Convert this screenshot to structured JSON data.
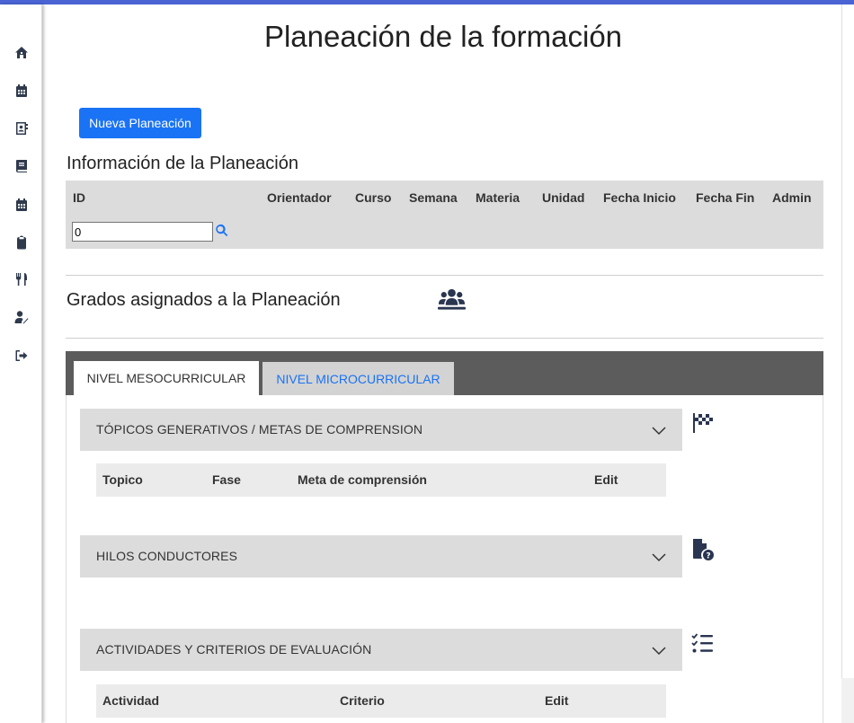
{
  "page": {
    "title": "Planeación de la formación",
    "new_button": "Nueva Planeación"
  },
  "sidebar": {
    "items": [
      {
        "icon": "home-icon"
      },
      {
        "icon": "calendar-icon"
      },
      {
        "icon": "contact-book-icon"
      },
      {
        "icon": "book-icon"
      },
      {
        "icon": "calendar-icon"
      },
      {
        "icon": "clipboard-icon"
      },
      {
        "icon": "utensils-icon"
      },
      {
        "icon": "user-edit-icon"
      },
      {
        "icon": "sign-out-icon"
      }
    ]
  },
  "info": {
    "title": "Información de la Planeación",
    "columns": [
      "ID",
      "Orientador",
      "Curso",
      "Semana",
      "Materia",
      "Unidad",
      "Fecha Inicio",
      "Fecha Fin",
      "Admin"
    ],
    "id_value": "0"
  },
  "grados": {
    "title": "Grados asignados a la Planeación"
  },
  "tabs": {
    "active": "NIVEL MESOCURRICULAR",
    "inactive": "NIVEL MICROCURRICULAR"
  },
  "sections": {
    "topicos": {
      "label": "TÓPICOS GENERATIVOS / METAS DE COMPRENSION",
      "columns": [
        "Topico",
        "Fase",
        "Meta de comprensión",
        "Edit"
      ]
    },
    "hilos": {
      "label": "HILOS CONDUCTORES"
    },
    "actividades": {
      "label": "ACTIVIDADES Y CRITERIOS DE EVALUACIÓN",
      "columns": [
        "Actividad",
        "Criterio",
        "Edit"
      ]
    }
  },
  "colors": {
    "primary": "#1a73f5",
    "topbar": "#4a64d4",
    "tabbar": "#5c5c5c",
    "icon": "#2a3550"
  }
}
